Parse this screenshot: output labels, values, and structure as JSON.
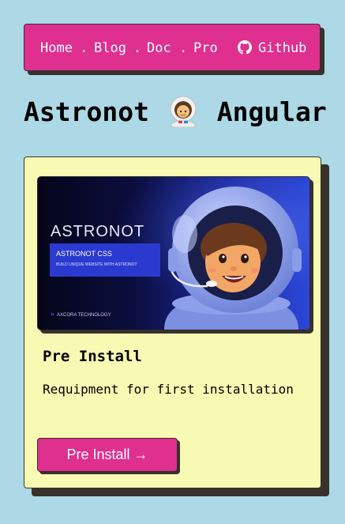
{
  "nav": {
    "items": [
      {
        "label": "Home"
      },
      {
        "label": "Blog"
      },
      {
        "label": "Doc"
      },
      {
        "label": "Pro"
      }
    ],
    "separator": ".",
    "github_label": "Github",
    "github_icon": "github-icon"
  },
  "page_title": {
    "left": "Astronot",
    "right": "Angular",
    "icon": "astronaut-emoji"
  },
  "card": {
    "banner": {
      "headline": "ASTRONOT",
      "box_title": "ASTRONOT CSS",
      "box_subtitle": "BUILD UNIQUE WEBSITE WITH ASTRONOT",
      "footer": "AXCORA TECHNOLOGY"
    },
    "title": "Pre Install",
    "description": "Requipment for first installation",
    "button_label": "Pre Install →"
  },
  "colors": {
    "background": "#add8e6",
    "accent": "#df2f8f",
    "card": "#f7fab3",
    "shadow": "#38312c"
  }
}
